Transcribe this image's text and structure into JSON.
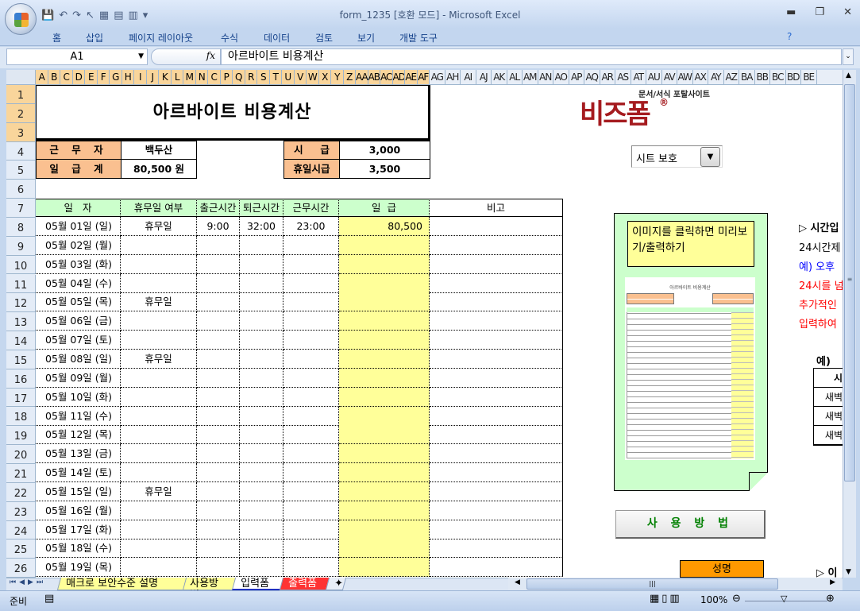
{
  "window": {
    "title": "form_1235  [호환 모드] - Microsoft Excel",
    "minimize": "▬",
    "restore": "❐",
    "close": "✕"
  },
  "ribbon": {
    "tabs": [
      "홈",
      "삽입",
      "페이지 레이아웃",
      "수식",
      "데이터",
      "검토",
      "보기",
      "개발 도구"
    ]
  },
  "formula_bar": {
    "name_box": "A1",
    "fx": "fx",
    "content": "아르바이트 비용계산"
  },
  "columns": [
    "A",
    "B",
    "C",
    "D",
    "E",
    "F",
    "G",
    "H",
    "I",
    "J",
    "K",
    "L",
    "M",
    "N",
    "C",
    "P",
    "Q",
    "R",
    "S",
    "T",
    "U",
    "V",
    "W",
    "X",
    "Y",
    "Z",
    "AA",
    "AB",
    "AC",
    "AD",
    "AE",
    "AF",
    "AG",
    "AH",
    "AI",
    "AJ",
    "AK",
    "AL",
    "AM",
    "AN",
    "AO",
    "AP",
    "AQ",
    "AR",
    "AS",
    "AT",
    "AU",
    "AV",
    "AW",
    "AX",
    "AY",
    "AZ",
    "BA",
    "BB",
    "BC",
    "BD",
    "BE"
  ],
  "rows": [
    "1",
    "2",
    "3",
    "4",
    "5",
    "6",
    "7",
    "8",
    "9",
    "10",
    "11",
    "12",
    "13",
    "14",
    "15",
    "16",
    "17",
    "18",
    "19",
    "20",
    "21",
    "22",
    "23",
    "24",
    "25",
    "26"
  ],
  "sheet": {
    "title": "아르바이트 비용계산",
    "worker_label": "근 무 자",
    "worker": "백두산",
    "total_label": "일 급 계",
    "total": "80,500 원",
    "hourly_label": "시     급",
    "hourly": "3,000",
    "holiday_hourly_label": "휴일시급",
    "holiday_hourly": "3,500",
    "headers": [
      "일   자",
      "휴무일 여부",
      "출근시간",
      "퇴근시간",
      "근무시간",
      "일  급",
      "비고"
    ],
    "records": [
      {
        "date": "05월 01일 (일)",
        "holiday": "휴무일",
        "in": "9:00",
        "out": "32:00",
        "hours": "23:00",
        "pay": "80,500"
      },
      {
        "date": "05월 02일 (월)"
      },
      {
        "date": "05월 03일 (화)"
      },
      {
        "date": "05월 04일 (수)"
      },
      {
        "date": "05월 05일 (목)",
        "holiday": "휴무일"
      },
      {
        "date": "05월 06일 (금)"
      },
      {
        "date": "05월 07일 (토)"
      },
      {
        "date": "05월 08일 (일)",
        "holiday": "휴무일"
      },
      {
        "date": "05월 09일 (월)"
      },
      {
        "date": "05월 10일 (화)"
      },
      {
        "date": "05월 11일 (수)"
      },
      {
        "date": "05월 12일 (목)"
      },
      {
        "date": "05월 13일 (금)"
      },
      {
        "date": "05월 14일 (토)"
      },
      {
        "date": "05월 15일 (일)",
        "holiday": "휴무일"
      },
      {
        "date": "05월 16일 (월)"
      },
      {
        "date": "05월 17일 (화)"
      },
      {
        "date": "05월 18일 (수)"
      },
      {
        "date": "05월 19일 (목)"
      }
    ]
  },
  "side": {
    "logo_brand": "비즈폼",
    "logo_tagline": "문서/서식 포탈사이트",
    "protect_dropdown": "시트 보호",
    "note": "이미지를 클릭하면 미리보기/출력하기",
    "thumb_title": "아르바이트 비용계산",
    "howto_button": "사 용 방 법",
    "name_box": "성명",
    "help_lines": [
      {
        "text": "▷ 시간입",
        "color": "#000000"
      },
      {
        "text": "24시간제",
        "color": "#000000"
      },
      {
        "text": "예) 오후",
        "color": "#0000ff"
      },
      {
        "text": "24시를 넘",
        "color": "#ff0000"
      },
      {
        "text": "추가적인",
        "color": "#ff0000"
      },
      {
        "text": "입력하여",
        "color": "#ff0000"
      }
    ],
    "example_label": "예)",
    "example_table": [
      "시",
      "새벽",
      "새벽",
      "새벽"
    ],
    "bottom_help": "▷ 이"
  },
  "sheet_tabs": [
    {
      "label": "매크로 보안수준 설명",
      "bg": "#ffff99"
    },
    {
      "label": "사용방법",
      "bg": "#ffff99"
    },
    {
      "label": "입력폼",
      "bg": "#ffffff",
      "active": true
    },
    {
      "label": "출력폼",
      "bg": "#ff3333"
    }
  ],
  "status": {
    "ready": "준비",
    "zoom": "100%"
  }
}
